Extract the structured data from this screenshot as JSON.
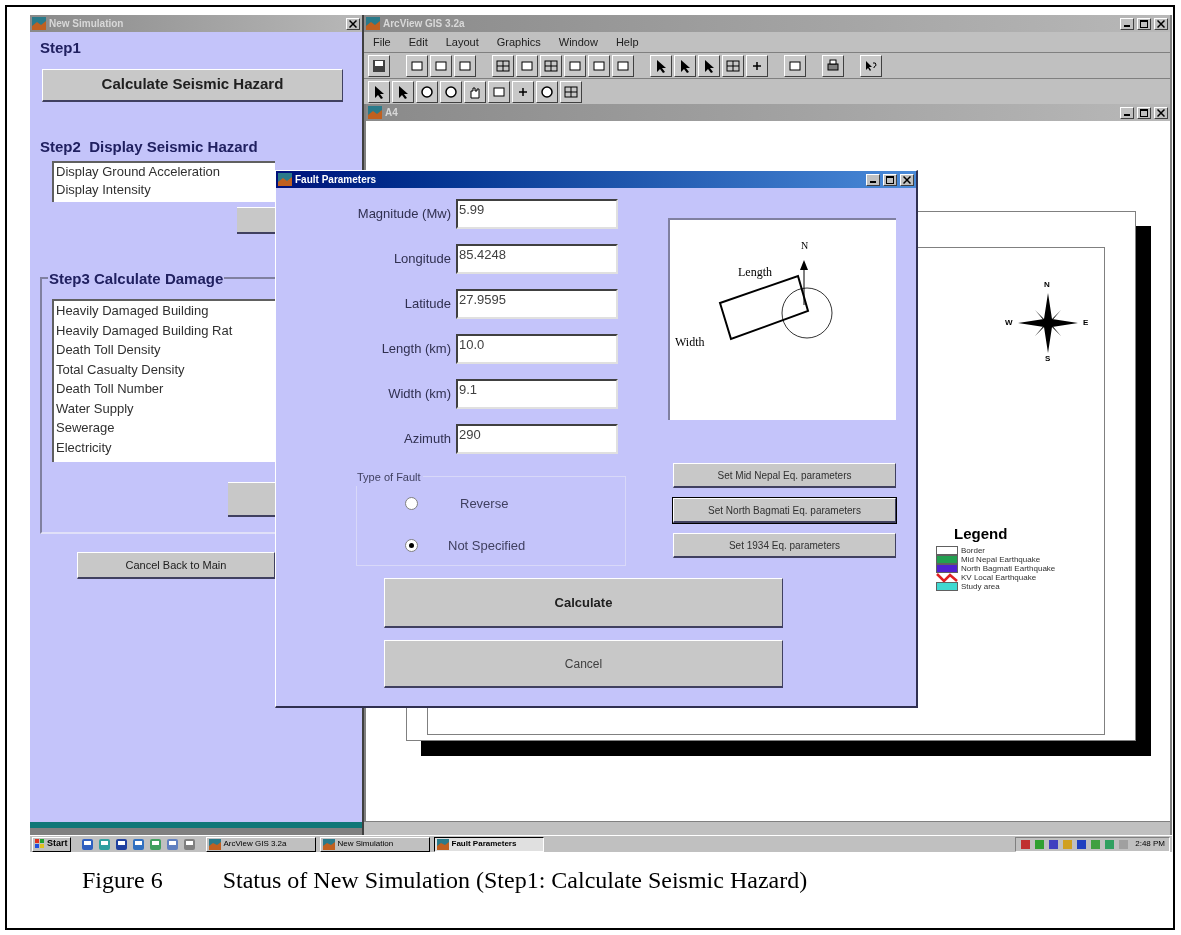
{
  "simulation_window": {
    "title": "New Simulation",
    "active": false,
    "step1": {
      "heading": "Step1",
      "button": "Calculate Seismic Hazard"
    },
    "step2": {
      "heading": "Step2  Display Seismic Hazard",
      "items": [
        "Display Ground Acceleration",
        "Display Intensity"
      ]
    },
    "step3": {
      "heading": "Step3 Calculate Damage",
      "items": [
        "Heavily Damaged Building",
        "Heavily Damaged Building Rat",
        "Death Toll Density",
        "Total Casualty Density",
        "Death Toll Number",
        "Water Supply",
        "Sewerage",
        "Electricity"
      ]
    },
    "cancel_button": "Cancel Back to Main"
  },
  "arcview_window": {
    "title": "ArcView GIS 3.2a",
    "active": false,
    "menu": [
      "File",
      "Edit",
      "Layout",
      "Graphics",
      "Window",
      "Help"
    ],
    "layout_window": {
      "title": "A4"
    },
    "compass": {
      "north": "N",
      "west": "W",
      "east": "E",
      "south": "S"
    },
    "legend": {
      "title": "Legend",
      "items": [
        {
          "label": "Border",
          "color": "#ffffff",
          "kind": "fill"
        },
        {
          "label": "Mid Nepal Earthquake",
          "color": "#22a050",
          "kind": "fill"
        },
        {
          "label": "North Bagmati Earthquake",
          "color": "#5020d0",
          "kind": "fill"
        },
        {
          "label": "KV Local Earthquake",
          "color": "#e02020",
          "kind": "line"
        },
        {
          "label": "Study area",
          "color": "#40d8d0",
          "kind": "fill"
        }
      ]
    }
  },
  "fault_dialog": {
    "title": "Fault Parameters",
    "active": true,
    "fields": [
      {
        "label": "Magnitude (Mw)",
        "value": "5.99"
      },
      {
        "label": "Longitude",
        "value": "85.4248"
      },
      {
        "label": "Latitude",
        "value": "27.9595"
      },
      {
        "label": "Length (km)",
        "value": "10.0"
      },
      {
        "label": "Width (km)",
        "value": "9.1"
      },
      {
        "label": "Azimuth",
        "value": "290"
      }
    ],
    "fault_type": {
      "heading": "Type of Fault",
      "options": [
        {
          "label": "Reverse",
          "selected": false
        },
        {
          "label": "Not Specified",
          "selected": true
        }
      ]
    },
    "diagram": {
      "length": "Length",
      "width": "Width",
      "north": "N"
    },
    "preset_buttons": [
      {
        "label": "Set Mid Nepal Eq. parameters",
        "focused": false
      },
      {
        "label": "Set North Bagmati Eq. parameters",
        "focused": true
      },
      {
        "label": "Set 1934 Eq. parameters",
        "focused": false
      }
    ],
    "calculate_button": "Calculate",
    "cancel_button": "Cancel"
  },
  "taskbar": {
    "start": "Start",
    "tasks": [
      {
        "label": "ArcView GIS 3.2a",
        "selected": false
      },
      {
        "label": "New Simulation",
        "selected": false
      },
      {
        "label": "Fault Parameters",
        "selected": true
      }
    ],
    "clock": "2:48 PM"
  },
  "figure_caption": {
    "number": "Figure 6",
    "text": "Status of New Simulation (Step1: Calculate Seismic Hazard)"
  }
}
